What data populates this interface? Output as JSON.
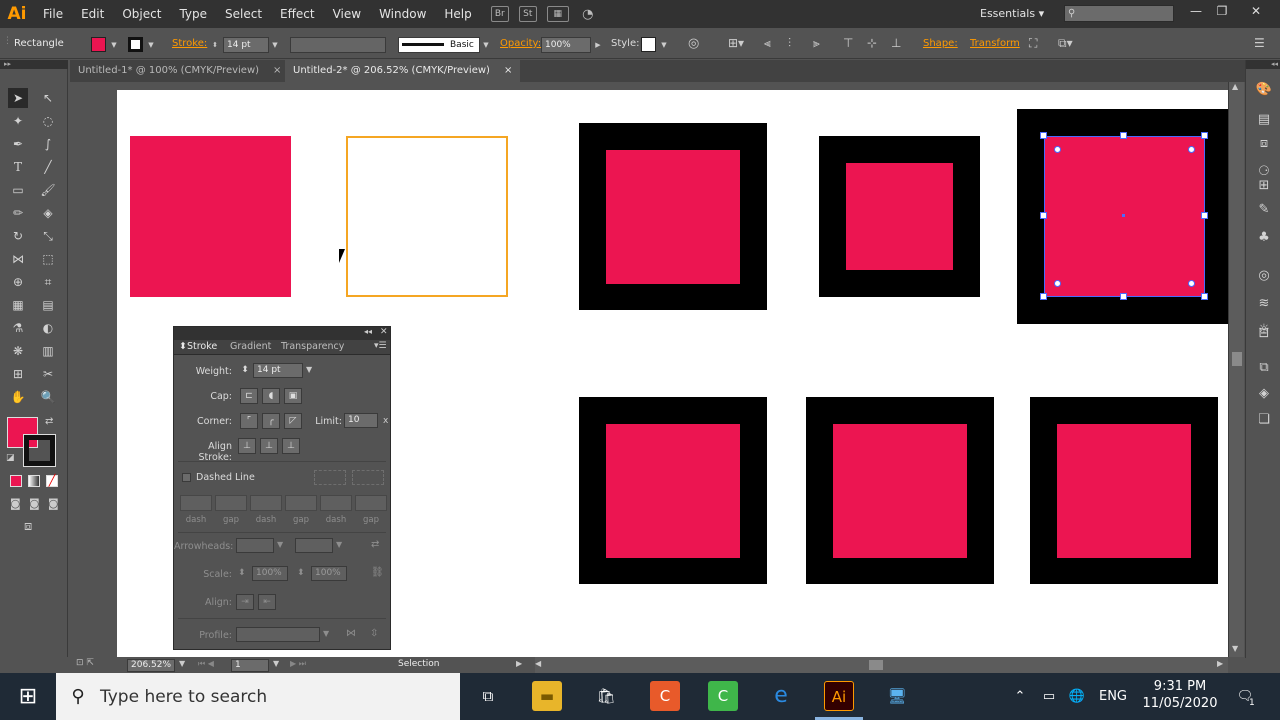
{
  "app": {
    "logo": "Ai",
    "menu": [
      "File",
      "Edit",
      "Object",
      "Type",
      "Select",
      "Effect",
      "View",
      "Window",
      "Help"
    ],
    "menubar_icons": [
      "Br",
      "St"
    ],
    "workspace": "Essentials",
    "workspace_caret": "▾"
  },
  "control_bar": {
    "tool_name": "Rectangle",
    "fill_color": "#ec1551",
    "stroke_label": "Stroke:",
    "stroke_weight": "14 pt",
    "brush_label": "Basic",
    "opacity_label": "Opacity:",
    "opacity_value": "100%",
    "style_label": "Style:",
    "shape_label": "Shape:",
    "transform_label": "Transform"
  },
  "doc_tabs": [
    {
      "label": "Untitled-1* @ 100% (CMYK/Preview)",
      "close": "×"
    },
    {
      "label": "Untitled-2* @ 206.52% (CMYK/Preview)",
      "close": "×"
    }
  ],
  "colors": {
    "pink": "#ec1551",
    "orange_outline": "#f5a623",
    "selection_blue": "#4a6bff"
  },
  "stroke_panel": {
    "tabs": [
      "Stroke",
      "Gradient",
      "Transparency"
    ],
    "weight_label": "Weight:",
    "weight_value": "14 pt",
    "cap_label": "Cap:",
    "corner_label": "Corner:",
    "limit_label": "Limit:",
    "limit_value": "10",
    "limit_unit": "x",
    "align_label": "Align Stroke:",
    "dashed_label": "Dashed Line",
    "dash_labels": [
      "dash",
      "gap",
      "dash",
      "gap",
      "dash",
      "gap"
    ],
    "arrowheads_label": "Arrowheads:",
    "scale_label": "Scale:",
    "scale_value_1": "100%",
    "scale_value_2": "100%",
    "align_arrow_label": "Align:",
    "profile_label": "Profile:"
  },
  "status_bar": {
    "zoom": "206.52%",
    "artboard_num": "1",
    "tool_status": "Selection"
  },
  "taskbar": {
    "search_placeholder": "Type here to search",
    "lang": "ENG",
    "time": "9:31 PM",
    "date": "11/05/2020",
    "notification_count": "1",
    "ai_app_label": "Ai"
  }
}
